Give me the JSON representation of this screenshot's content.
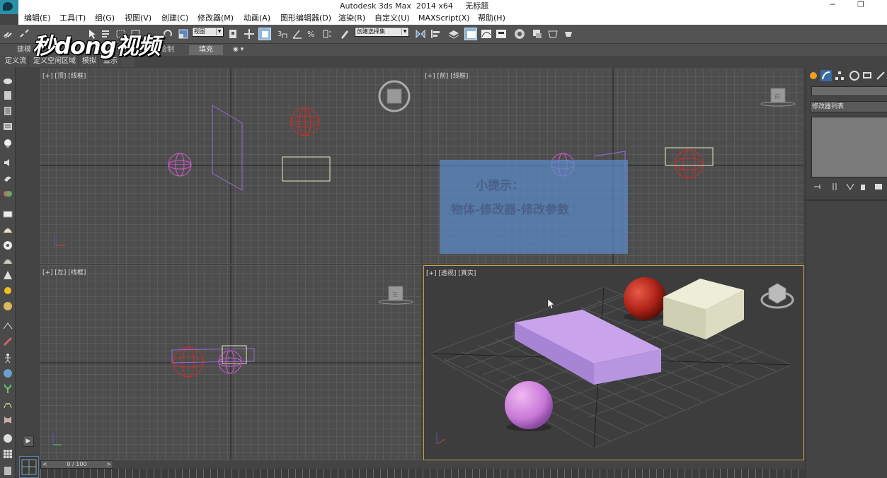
{
  "window": {
    "title": "Autodesk 3ds Max  2014 x64     无标题",
    "minimize": "─",
    "restore": "❐"
  },
  "menu": [
    "编辑(E)",
    "工具(T)",
    "组(G)",
    "视图(V)",
    "创建(C)",
    "修改器(M)",
    "动画(A)",
    "图形编辑器(D)",
    "渲染(R)",
    "自定义(U)",
    "MAXScript(X)",
    "帮助(H)"
  ],
  "toolbar": {
    "view_select": "视图",
    "selection_set": "创建选择集"
  },
  "ribbon": {
    "tabs": [
      "建模",
      "绘制",
      "填充"
    ]
  },
  "subribbon": [
    "定义流",
    "定义空闲区域",
    "模拟",
    "显示"
  ],
  "watermark": "秒dong视频",
  "viewports": {
    "top": "[+] [顶] [线框]",
    "front": "[+] [前] [线框]",
    "left": "[+] [左] [线框]",
    "perspective": "[+] [透视] [真实]"
  },
  "viewcube_labels": {
    "front": "前",
    "left": "左"
  },
  "tip": {
    "title": "小提示：",
    "body": "物体-修改器-修改参数"
  },
  "command_panel": {
    "modifier_list": "修改器列表"
  },
  "timeline": {
    "frame": "0 / 100",
    "prev": "<",
    "next": ">"
  },
  "colors": {
    "accent_active_viewport": "#c8a64a",
    "sphere_red": "#c83a2e",
    "sphere_magenta": "#d45ad4",
    "box_purple": "#b58fe8",
    "box_cream": "#dcdcc4"
  }
}
